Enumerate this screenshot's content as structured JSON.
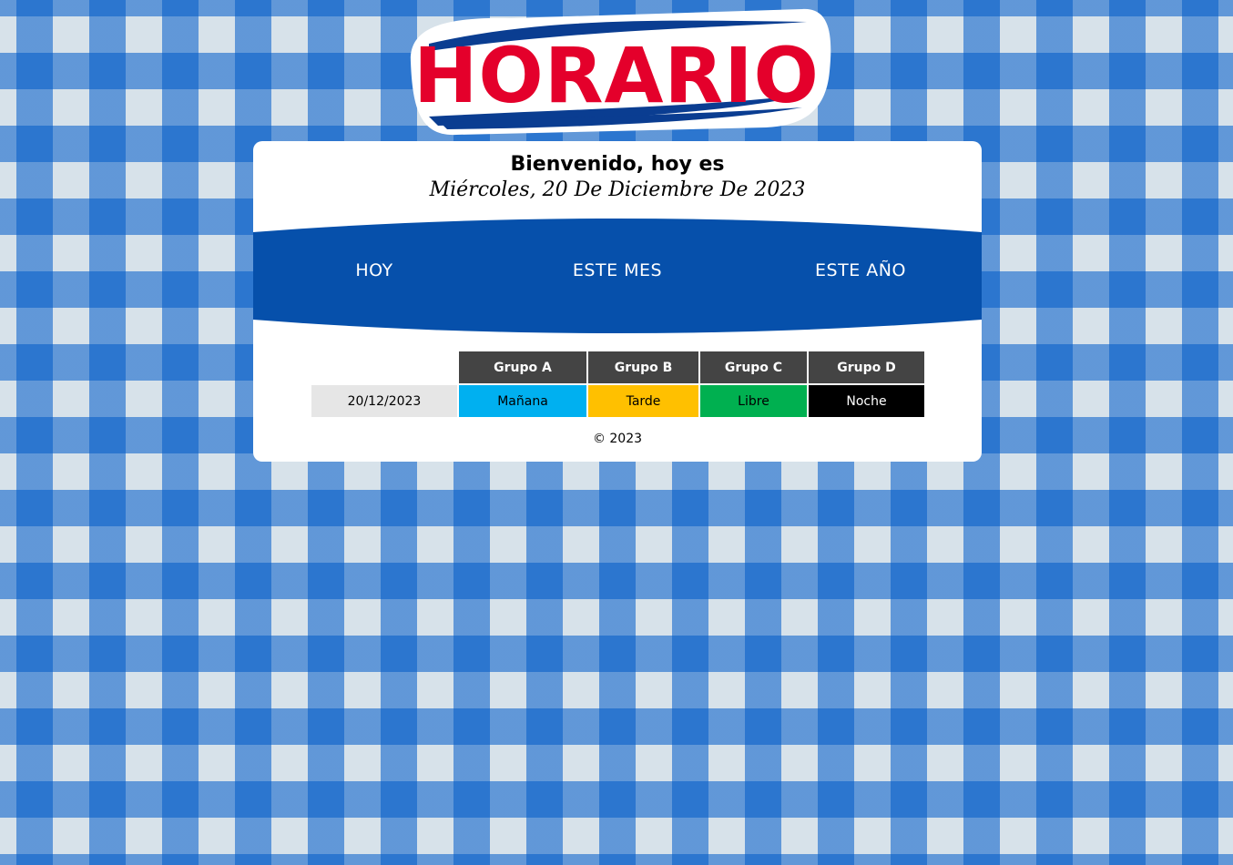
{
  "logo": {
    "text": "HORARIO",
    "text_color": "#e4002b",
    "swoosh_color": "#0a3d91"
  },
  "header": {
    "welcome": "Bienvenido, hoy es",
    "date_long": "Miércoles, 20 De Diciembre De 2023"
  },
  "nav": {
    "background": "#0650ab",
    "items": [
      {
        "label": "HOY"
      },
      {
        "label": "ESTE MES"
      },
      {
        "label": "ESTE AÑO"
      }
    ]
  },
  "schedule": {
    "headers": [
      "Grupo A",
      "Grupo B",
      "Grupo C",
      "Grupo D"
    ],
    "rows": [
      {
        "date": "20/12/2023",
        "shifts": [
          {
            "label": "Mañana",
            "color": "#00b0f0"
          },
          {
            "label": "Tarde",
            "color": "#ffc000"
          },
          {
            "label": "Libre",
            "color": "#00b050"
          },
          {
            "label": "Noche",
            "color": "#000000"
          }
        ]
      }
    ]
  },
  "footer": {
    "text": "© 2023"
  },
  "theme": {
    "background_pattern": "blue-gingham",
    "header_cell_color": "#444444"
  }
}
